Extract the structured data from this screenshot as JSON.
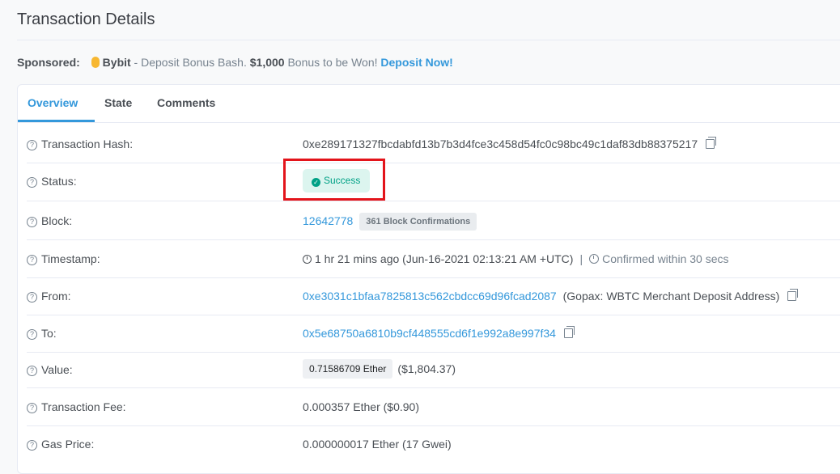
{
  "page": {
    "title": "Transaction Details"
  },
  "sponsor": {
    "label": "Sponsored:",
    "brand": "Bybit",
    "text1": " - Deposit Bonus Bash. ",
    "amount": "$1,000",
    "text2": " Bonus to be Won! ",
    "link": "Deposit Now!"
  },
  "tabs": [
    {
      "label": "Overview"
    },
    {
      "label": "State"
    },
    {
      "label": "Comments"
    }
  ],
  "rows": {
    "hash": {
      "label": "Transaction Hash:",
      "value": "0xe289171327fbcdabfd13b7b3d4fce3c458d54fc0c98bc49c1daf83db88375217"
    },
    "status": {
      "label": "Status:",
      "value": "Success"
    },
    "block": {
      "label": "Block:",
      "value": "12642778",
      "confirmations": "361 Block Confirmations"
    },
    "timestamp": {
      "label": "Timestamp:",
      "value": "1 hr 21 mins ago (Jun-16-2021 02:13:21 AM +UTC)",
      "separator": "|",
      "confirmed": "Confirmed within 30 secs"
    },
    "from": {
      "label": "From:",
      "address": "0xe3031c1bfaa7825813c562cbdcc69d96fcad2087",
      "name": "(Gopax: WBTC Merchant Deposit Address)"
    },
    "to": {
      "label": "To:",
      "address": "0x5e68750a6810b9cf448555cd6f1e992a8e997f34"
    },
    "value": {
      "label": "Value:",
      "ether": "0.71586709 Ether",
      "usd": "($1,804.37)"
    },
    "fee": {
      "label": "Transaction Fee:",
      "value": "0.000357 Ether ($0.90)"
    },
    "gas": {
      "label": "Gas Price:",
      "value": "0.000000017 Ether (17 Gwei)"
    }
  },
  "colors": {
    "accent": "#3498db",
    "success": "#00a186",
    "highlight": "#e3141b"
  },
  "icons": {
    "help": "question-circle-icon",
    "copy": "copy-icon",
    "success": "check-circle-icon",
    "clock": "clock-icon",
    "timer": "timer-icon",
    "coin": "coin-icon"
  }
}
